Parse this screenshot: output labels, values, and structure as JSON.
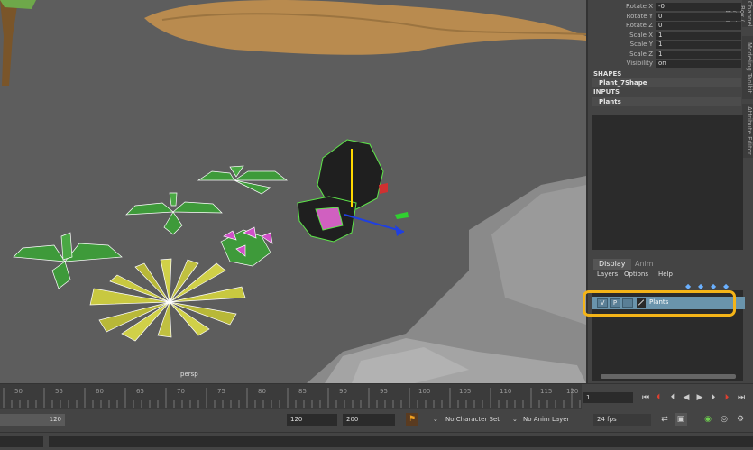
{
  "viewport": {
    "camera": "persp"
  },
  "attributes": [
    {
      "label": "Rotate X",
      "value": "-0"
    },
    {
      "label": "Rotate Y",
      "value": "0"
    },
    {
      "label": "Rotate Z",
      "value": "0"
    },
    {
      "label": "Scale X",
      "value": "1"
    },
    {
      "label": "Scale Y",
      "value": "1"
    },
    {
      "label": "Scale Z",
      "value": "1"
    },
    {
      "label": "Visibility",
      "value": "on"
    }
  ],
  "side_tabs": [
    "Channel Box / Layer Editor",
    "Modeling Toolkit",
    "Attribute Editor"
  ],
  "shapes": {
    "heading": "SHAPES",
    "value": "Plant_7Shape"
  },
  "inputs": {
    "heading": "INPUTS",
    "value": "Plants"
  },
  "layer_panel": {
    "tabs": [
      "Display",
      "Anim"
    ],
    "menu": [
      "Layers",
      "Options",
      "Help"
    ],
    "layer": {
      "v": "V",
      "p": "P",
      "name": "Plants"
    }
  },
  "timeline": {
    "ticks": [
      "50",
      "55",
      "60",
      "65",
      "70",
      "75",
      "80",
      "85",
      "90",
      "95",
      "100",
      "105",
      "110",
      "115",
      "120"
    ],
    "current_frame": "1"
  },
  "range": {
    "slider_end": "120",
    "end": "120",
    "max": "200",
    "character_set": "No Character Set",
    "anim_layer": "No Anim Layer",
    "fps": "24 fps"
  },
  "colors": {
    "layer_row": "#6a94ac",
    "highlight": "#f4b418",
    "selection": "#5ee64a"
  }
}
